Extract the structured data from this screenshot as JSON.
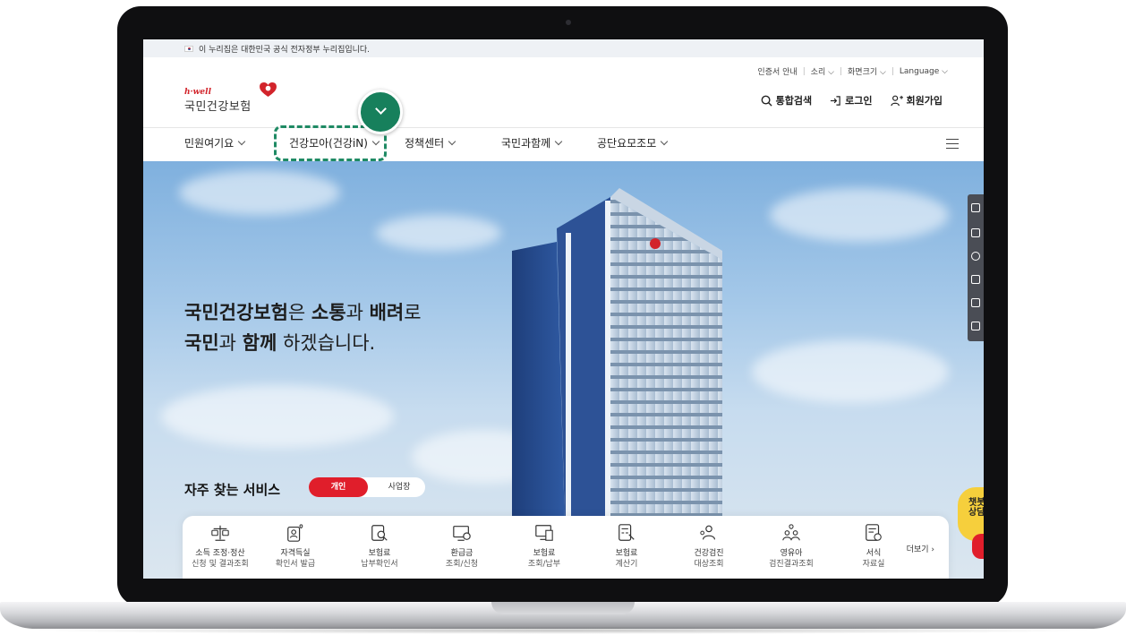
{
  "gov_bar": {
    "text": "이 누리집은 대한민국 공식 전자정부 누리집입니다."
  },
  "utility": {
    "cert_guide": "인증서 안내",
    "sound": "소리",
    "screen_size": "화면크기",
    "language": "Language"
  },
  "logo": {
    "small": "h·well",
    "big": "국민건강보험"
  },
  "top_actions": {
    "search": "통합검색",
    "login": "로그인",
    "join": "회원가입"
  },
  "gnb": {
    "items": [
      {
        "label": "민원여기요"
      },
      {
        "label": "건강모아(건강iN)"
      },
      {
        "label": "정책센터"
      },
      {
        "label": "국민과함께"
      },
      {
        "label": "공단요모조모"
      }
    ]
  },
  "hero": {
    "line1_a": "국민건강보험",
    "line1_b": "은 ",
    "line1_c": "소통",
    "line1_d": "과 ",
    "line1_e": "배려",
    "line1_f": "로",
    "line2_a": "국민",
    "line2_b": "과 ",
    "line2_c": "함께",
    "line2_d": " 하겠습니다."
  },
  "services": {
    "title": "자주 찾는 서비스",
    "tab_personal": "개인",
    "tab_business": "사업장",
    "more": "더보기",
    "items": [
      {
        "l1": "소득 조정·정산",
        "l2": "신청 및 결과조회",
        "icon": "scale-icon"
      },
      {
        "l1": "자격득실",
        "l2": "확인서 발급",
        "icon": "person-heart-icon"
      },
      {
        "l1": "보험료",
        "l2": "납부확인서",
        "icon": "document-search-icon"
      },
      {
        "l1": "환급금",
        "l2": "조회/신청",
        "icon": "monitor-coin-icon"
      },
      {
        "l1": "보험료",
        "l2": "조회/납부",
        "icon": "monitor-doc-icon"
      },
      {
        "l1": "보험료",
        "l2": "계산기",
        "icon": "calculator-icon"
      },
      {
        "l1": "건강검진",
        "l2": "대상조회",
        "icon": "people-icon"
      },
      {
        "l1": "영유아",
        "l2": "검진결과조회",
        "icon": "family-heart-icon"
      },
      {
        "l1": "서식",
        "l2": "자료실",
        "icon": "form-icon"
      }
    ]
  },
  "chatbot": {
    "l1": "챗봇",
    "l2": "상담"
  },
  "colors": {
    "brand_red": "#e01e2b",
    "highlight_green": "#1f8a64",
    "sky": "#a6c9e9"
  }
}
